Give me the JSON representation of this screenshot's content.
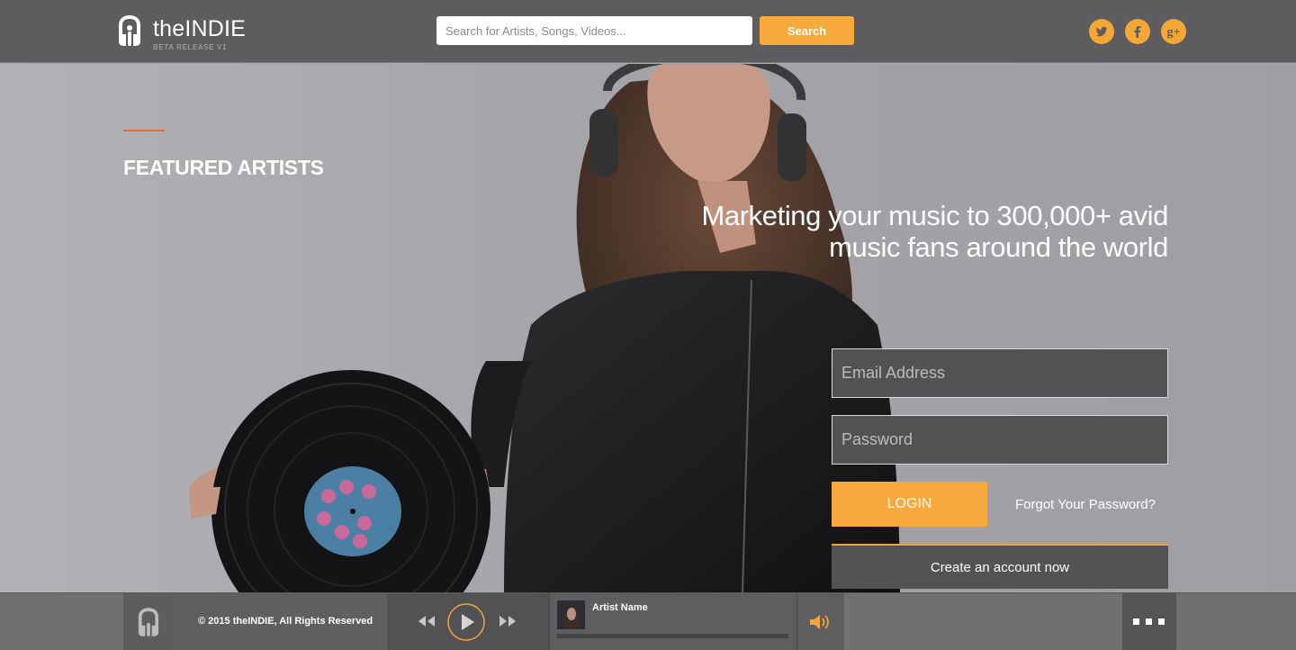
{
  "header": {
    "brand_name": "theINDIE",
    "brand_subtitle": "BETA RELEASE V1",
    "search_placeholder": "Search for Artists, Songs, Videos...",
    "search_button": "Search",
    "social": [
      {
        "icon": "twitter-icon",
        "glyph": "t"
      },
      {
        "icon": "facebook-icon",
        "glyph": "f"
      },
      {
        "icon": "google-plus-icon",
        "glyph": "g+"
      }
    ]
  },
  "hero": {
    "section_title": "FEATURED ARTISTS",
    "tagline_line1": "Marketing your music to 300,000+ avid",
    "tagline_line2": "music fans around the world"
  },
  "login_form": {
    "email_placeholder": "Email Address",
    "password_placeholder": "Password",
    "login_button": "LOGIN",
    "forgot_link": "Forgot Your Password?",
    "create_account_button": "Create an account now"
  },
  "player": {
    "copyright": "© 2015 theINDIE, All Rights Reserved",
    "artist_name": "Artist Name",
    "progress": 0,
    "more_label": "..."
  },
  "colors": {
    "accent_orange": "#f7a93b",
    "header_bg": "#5d5c5e",
    "accent_line": "#ef6a2c"
  }
}
